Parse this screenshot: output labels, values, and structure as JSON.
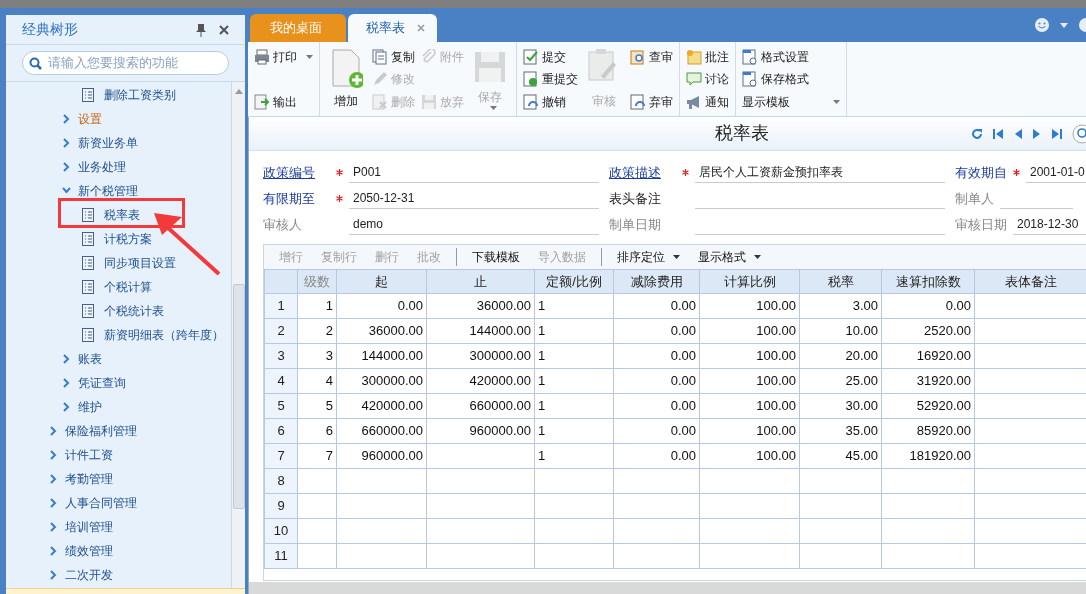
{
  "sidebar": {
    "title": "经典树形",
    "search": {
      "placeholder": "请输入您要搜索的功能"
    },
    "branch_items": [
      {
        "label": "删除工资类别",
        "kind": "page",
        "hovered": false
      },
      {
        "label": "设置",
        "kind": "folder",
        "hovered": true,
        "expanded": false
      },
      {
        "label": "薪资业务单",
        "kind": "folder",
        "hovered": false,
        "expanded": false
      },
      {
        "label": "业务处理",
        "kind": "folder",
        "hovered": false,
        "expanded": false
      },
      {
        "label": "新个税管理",
        "kind": "folder",
        "hovered": false,
        "expanded": true,
        "children": [
          {
            "label": "税率表",
            "kind": "page",
            "hovered": false
          },
          {
            "label": "计税方案",
            "kind": "page",
            "hovered": false
          },
          {
            "label": "同步项目设置",
            "kind": "page",
            "hovered": false
          },
          {
            "label": "个税计算",
            "kind": "page",
            "hovered": false
          },
          {
            "label": "个税统计表",
            "kind": "page",
            "hovered": false
          },
          {
            "label": "薪资明细表（跨年度）",
            "kind": "page",
            "hovered": false
          }
        ]
      },
      {
        "label": "账表",
        "kind": "folder",
        "hovered": false,
        "expanded": false
      },
      {
        "label": "凭证查询",
        "kind": "folder",
        "hovered": false,
        "expanded": false
      },
      {
        "label": "维护",
        "kind": "folder",
        "hovered": false,
        "expanded": false
      }
    ],
    "items": [
      {
        "label": "保险福利管理",
        "expanded": false
      },
      {
        "label": "计件工资",
        "expanded": false
      },
      {
        "label": "考勤管理",
        "expanded": false
      },
      {
        "label": "人事合同管理",
        "expanded": false
      },
      {
        "label": "培训管理",
        "expanded": false
      },
      {
        "label": "绩效管理",
        "expanded": false
      },
      {
        "label": "二次开发",
        "expanded": false
      }
    ]
  },
  "tabs": [
    {
      "label": "我的桌面",
      "selected": false
    },
    {
      "label": "税率表",
      "selected": true
    }
  ],
  "toolbar": {
    "groups": [
      {
        "columns": [
          {
            "kind": "stack",
            "buttons": [
              {
                "label": "打印",
                "disabled": false,
                "menu": true
              },
              {
                "label": "输出",
                "disabled": false,
                "menu": false
              }
            ]
          }
        ]
      },
      {
        "columns": [
          {
            "kind": "large",
            "buttons": [
              {
                "label": "增加",
                "disabled": false,
                "menu": false
              }
            ]
          },
          {
            "kind": "stack",
            "buttons": [
              {
                "label": "复制",
                "disabled": false,
                "menu": false
              },
              {
                "label": "修改",
                "disabled": true,
                "menu": false
              },
              {
                "label": "删除",
                "disabled": true,
                "menu": false
              }
            ]
          },
          {
            "kind": "stack",
            "buttons": [
              {
                "label": "附件",
                "disabled": true,
                "menu": false
              },
              {
                "label": "放弃",
                "disabled": true,
                "menu": false
              }
            ]
          },
          {
            "kind": "large",
            "buttons": [
              {
                "label": "保存",
                "disabled": true,
                "menu": true
              }
            ]
          }
        ]
      },
      {
        "columns": [
          {
            "kind": "stack",
            "buttons": [
              {
                "label": "提交",
                "disabled": false,
                "menu": false
              },
              {
                "label": "重提交",
                "disabled": false,
                "menu": false
              },
              {
                "label": "撤销",
                "disabled": false,
                "menu": false
              }
            ]
          },
          {
            "kind": "large",
            "buttons": [
              {
                "label": "审核",
                "disabled": true,
                "menu": false
              }
            ]
          },
          {
            "kind": "stack",
            "buttons": [
              {
                "label": "查审",
                "disabled": false,
                "menu": false
              },
              {
                "label": "弃审",
                "disabled": false,
                "menu": false
              }
            ]
          }
        ]
      },
      {
        "columns": [
          {
            "kind": "stack",
            "buttons": [
              {
                "label": "批注",
                "disabled": false,
                "menu": false
              },
              {
                "label": "讨论",
                "disabled": false,
                "menu": false
              },
              {
                "label": "通知",
                "disabled": false,
                "menu": false
              }
            ]
          }
        ]
      },
      {
        "columns": [
          {
            "kind": "stack",
            "buttons": [
              {
                "label": "格式设置",
                "disabled": false,
                "menu": false
              },
              {
                "label": "保存格式",
                "disabled": false,
                "menu": false
              },
              {
                "label": "显示模板",
                "disabled": false,
                "menu": true
              }
            ]
          }
        ]
      }
    ]
  },
  "form": {
    "title": "税率表",
    "fields": [
      {
        "label": "政策编号",
        "kind": "link",
        "required": true,
        "value": "P001"
      },
      {
        "label": "政策描述",
        "kind": "link",
        "required": true,
        "value": "居民个人工资薪金预扣率表"
      },
      {
        "label": "有效期自",
        "kind": "emphasis",
        "required": true,
        "value": "2001-01-0"
      },
      {
        "label": "有限期至",
        "kind": "emphasis",
        "required": true,
        "value": "2050-12-31"
      },
      {
        "label": "表头备注",
        "kind": "plain",
        "required": false
      },
      {
        "label": "制单人",
        "kind": "muted",
        "required": false
      },
      {
        "label": "审核人",
        "kind": "muted",
        "required": false,
        "value": "demo"
      },
      {
        "label": "制单日期",
        "kind": "muted",
        "required": false
      },
      {
        "label": "审核日期",
        "kind": "muted",
        "required": false,
        "value": "2018-12-30"
      }
    ]
  },
  "grid_toolbar": {
    "groups": [
      [
        {
          "label": "增行",
          "disabled": true,
          "menu": false
        },
        {
          "label": "复制行",
          "disabled": true,
          "menu": false
        },
        {
          "label": "删行",
          "disabled": true,
          "menu": false
        },
        {
          "label": "批改",
          "disabled": true,
          "menu": false
        }
      ],
      [
        {
          "label": "下载模板",
          "disabled": false,
          "menu": false
        },
        {
          "label": "导入数据",
          "disabled": true,
          "menu": false
        }
      ],
      [
        {
          "label": "排序定位",
          "disabled": false,
          "menu": true
        },
        {
          "label": "显示格式",
          "disabled": false,
          "menu": true
        }
      ]
    ]
  },
  "table": {
    "columns": [
      "级数",
      "起",
      "止",
      "定额/比例",
      "减除费用",
      "计算比例",
      "税率",
      "速算扣除数",
      "表体备注"
    ],
    "rows": [
      {
        "row_header": "1",
        "cells": [
          "1",
          "0.00",
          "36000.00",
          "1",
          "0.00",
          "100.00",
          "3.00",
          "0.00"
        ]
      },
      {
        "row_header": "2",
        "cells": [
          "2",
          "36000.00",
          "144000.00",
          "1",
          "0.00",
          "100.00",
          "10.00",
          "2520.00"
        ]
      },
      {
        "row_header": "3",
        "cells": [
          "3",
          "144000.00",
          "300000.00",
          "1",
          "0.00",
          "100.00",
          "20.00",
          "16920.00"
        ]
      },
      {
        "row_header": "4",
        "cells": [
          "4",
          "300000.00",
          "420000.00",
          "1",
          "0.00",
          "100.00",
          "25.00",
          "31920.00"
        ]
      },
      {
        "row_header": "5",
        "cells": [
          "5",
          "420000.00",
          "660000.00",
          "1",
          "0.00",
          "100.00",
          "30.00",
          "52920.00"
        ]
      },
      {
        "row_header": "6",
        "cells": [
          "6",
          "660000.00",
          "960000.00",
          "1",
          "0.00",
          "100.00",
          "35.00",
          "85920.00"
        ]
      },
      {
        "row_header": "7",
        "cells": [
          "7",
          "960000.00",
          null,
          "1",
          "0.00",
          "100.00",
          "45.00",
          "181920.00"
        ]
      },
      {
        "row_header": "8"
      },
      {
        "row_header": "9"
      },
      {
        "row_header": "10"
      },
      {
        "row_header": "11"
      }
    ]
  }
}
